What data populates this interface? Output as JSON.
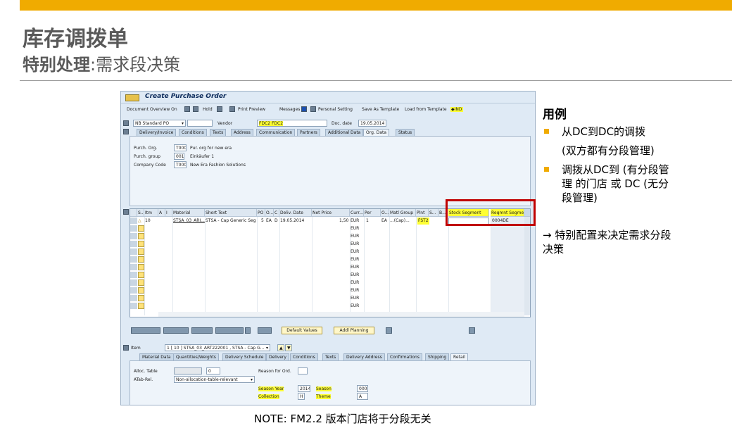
{
  "slide": {
    "title": "库存调拨单",
    "subtitle_bold": "特别处理",
    "subtitle_rest": ":需求段决策",
    "note": "NOTE:  FM2.2 版本门店将于分段无关"
  },
  "right": {
    "heading": "用例",
    "b1_l1": "从DC到DC的调拨",
    "b1_l2": "(双方都有分段管理)",
    "b2_l1": "调拨从DC到 (有分段管",
    "b2_l2": "理 的门店 或 DC (无分",
    "b2_l3": "段管理)",
    "arrow_l1": "→ 特别配置来决定需求分段",
    "arrow_l2": "决策"
  },
  "sap": {
    "window_title": "Create Purchase Order",
    "toolbar": {
      "doc_overview": "Document Overview On",
      "hold": "Hold",
      "print_preview": "Print Preview",
      "messages": "Messages",
      "personal_setting": "Personal Setting",
      "save_template": "Save As Template",
      "load_template": "Load from Template",
      "ind": "IND"
    },
    "header": {
      "doc_type": "NB Standard PO",
      "vendor_label": "Vendor",
      "vendor_value": "FDC2 FDC2",
      "doc_date_label": "Doc. date",
      "doc_date_value": "19.05.2014"
    },
    "header_tabs": [
      "Delivery/Invoice",
      "Conditions",
      "Texts",
      "Address",
      "Communication",
      "Partners",
      "Additional Data",
      "Org. Data",
      "Status"
    ],
    "org": {
      "purch_org_label": "Purch. Org.",
      "purch_org_code": "T000",
      "purch_org_text": "Pur. org for new era",
      "purch_group_label": "Purch. group",
      "purch_group_code": "001",
      "purch_group_text": "Einkäufer 1",
      "company_label": "Company Code",
      "company_code": "T000",
      "company_text": "New Era Fashion Solutions"
    },
    "grid": {
      "headers": [
        "S..",
        "Itm",
        "A",
        "I",
        "Material",
        "Short Text",
        "PO ...",
        "O...",
        "C",
        "Deliv. Date",
        "Net Price",
        "Curr...",
        "Per",
        "O...",
        "Matl Group",
        "Plnt",
        "S...",
        "B...",
        "Stock Segment",
        "Reqmnt Segment"
      ],
      "row1": {
        "itm": "10",
        "material": "STSA_03_ARI...",
        "short_text": "STSA - Cap Generic Seg ...",
        "po_qty": "5",
        "oun": "EA",
        "c": "D",
        "deliv_date": "19.05.2014",
        "net_price": "1,50",
        "curr": "EUR",
        "per": "1",
        "o": "EA",
        "matl_group": "...(Cap)...",
        "plnt": "FST2",
        "stock_seg": "",
        "reqmnt_seg": "0004DE"
      },
      "curr_empty": "EUR"
    },
    "buttons": {
      "default_values": "Default Values",
      "addl_planning": "Addl Planning"
    },
    "item": {
      "label": "Item",
      "value": "1 [ 10 ] STSA_03_ART222001 , STSA - Cap G..."
    },
    "item_tabs": [
      "Material Data",
      "Quantities/Weights",
      "Delivery Schedule",
      "Delivery",
      "Conditions",
      "Texts",
      "Delivery Address",
      "Confirmations",
      "Shipping",
      "Retail"
    ],
    "retail": {
      "alloc_table_label": "Alloc. Table",
      "alloc_table_value": "0",
      "reason_label": "Reason for Ord.",
      "atab_label": "ATab-Rel.",
      "atab_value": "Non-allocation-table-relevant",
      "season_year_label": "Season Year",
      "season_year_value": "2014",
      "season_label": "Season",
      "season_value": "0002",
      "collection_label": "Collection",
      "collection_value": "H",
      "theme_label": "Theme",
      "theme_value": "A"
    }
  }
}
